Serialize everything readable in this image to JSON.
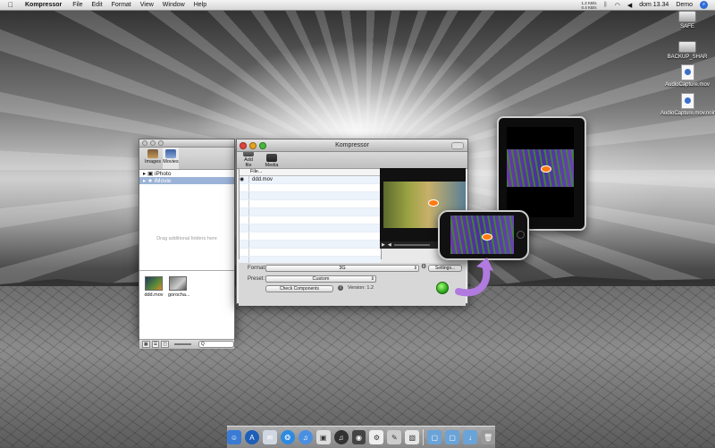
{
  "menubar": {
    "app_name": "Kompressor",
    "items": [
      "File",
      "Edit",
      "Format",
      "View",
      "Window",
      "Help"
    ],
    "net_up": "1.2 KB/s",
    "net_down": "0.4 KB/s",
    "clock": "dom 13.34",
    "user": "Demo"
  },
  "desktop_icons": [
    {
      "label": "SAFE",
      "icon": "drive-icon"
    },
    {
      "label": "BACKUP_SHAR",
      "icon": "drive-icon"
    },
    {
      "label": "AudioCapture.mov",
      "icon": "movie-file-icon"
    },
    {
      "label": "AudioCapture.mov.noindex",
      "icon": "movie-file-icon"
    }
  ],
  "media_browser": {
    "tabs": [
      "Images",
      "Movies"
    ],
    "selected_tab": "Movies",
    "sources": [
      "iPhoto",
      "iMovie"
    ],
    "hint": "Drag additional folders here",
    "items": [
      {
        "name": "ddd.mov"
      },
      {
        "name": "gorocha..."
      }
    ],
    "search_placeholder": "Q"
  },
  "main_window": {
    "title": "Kompressor",
    "toolbar": {
      "add_file": "Add file",
      "media": "Media"
    },
    "file_column": "File...",
    "files": [
      "ddd.mov"
    ],
    "format_label": "Format:",
    "format_value": "3G",
    "settings_button": "Settings...",
    "preset_label": "Preset:",
    "preset_value": "Custom",
    "check_button": "Check Components",
    "version": "Version: 1.2"
  },
  "colors": {
    "accent_blue": "#2f6bd6",
    "selection": "#9bb3d6",
    "go_green": "#1f9a12",
    "arrow_purple": "#b07adf"
  }
}
